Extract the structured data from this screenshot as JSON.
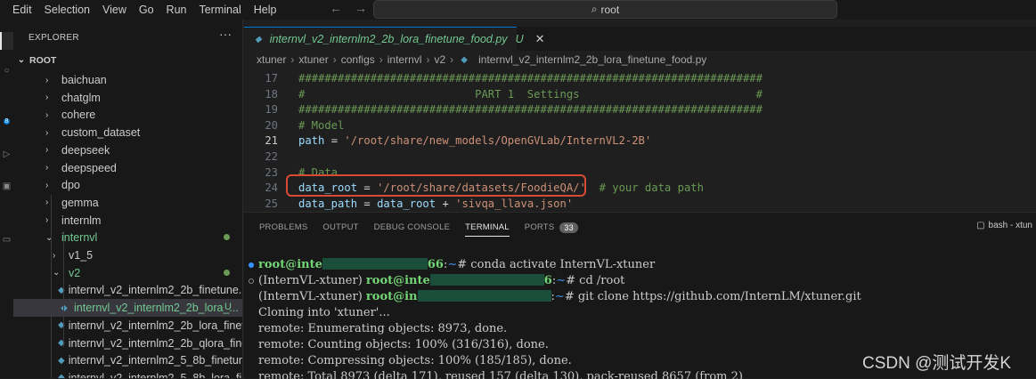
{
  "menubar": {
    "items": [
      "Edit",
      "Selection",
      "View",
      "Go",
      "Run",
      "Terminal",
      "Help"
    ]
  },
  "search": {
    "text": "root"
  },
  "sidebar": {
    "title": "EXPLORER",
    "more": "···",
    "root_label": "ROOT",
    "items": [
      {
        "label": "baichuan",
        "depth": 1,
        "chevron": "›"
      },
      {
        "label": "chatglm",
        "depth": 1,
        "chevron": "›"
      },
      {
        "label": "cohere",
        "depth": 1,
        "chevron": "›"
      },
      {
        "label": "custom_dataset",
        "depth": 1,
        "chevron": "›"
      },
      {
        "label": "deepseek",
        "depth": 1,
        "chevron": "›"
      },
      {
        "label": "deepspeed",
        "depth": 1,
        "chevron": "›"
      },
      {
        "label": "dpo",
        "depth": 1,
        "chevron": "›"
      },
      {
        "label": "gemma",
        "depth": 1,
        "chevron": "›"
      },
      {
        "label": "internlm",
        "depth": 1,
        "chevron": "›"
      },
      {
        "label": "internvl",
        "depth": 1,
        "chevron": "⌄",
        "green": true,
        "dot": true
      },
      {
        "label": "v1_5",
        "depth": 2,
        "chevron": "›"
      },
      {
        "label": "v2",
        "depth": 2,
        "chevron": "⌄",
        "green": true,
        "dot": true
      },
      {
        "label": "internvl_v2_internlm2_2b_finetune.py",
        "depth": 3,
        "file": true
      },
      {
        "label": "internvl_v2_internlm2_2b_lora_...",
        "depth": 3,
        "file": true,
        "green": true,
        "selected": true,
        "badge": "U"
      },
      {
        "label": "internvl_v2_internlm2_2b_lora_finet...",
        "depth": 3,
        "file": true
      },
      {
        "label": "internvl_v2_internlm2_2b_qlora_fine...",
        "depth": 3,
        "file": true
      },
      {
        "label": "internvl_v2_internlm2_5_8b_finetun...",
        "depth": 3,
        "file": true
      },
      {
        "label": "internvl_v2_internlm2_5_8b_lora_fi...",
        "depth": 3,
        "file": true
      }
    ]
  },
  "tab": {
    "title": "internvl_v2_internlm2_2b_lora_finetune_food.py",
    "status": "U",
    "close": "✕"
  },
  "breadcrumb": [
    "xtuner",
    "xtuner",
    "configs",
    "internvl",
    "v2",
    "internvl_v2_internlm2_2b_lora_finetune_food.py"
  ],
  "editor": {
    "lines": [
      {
        "n": "17",
        "parts": [
          [
            "com",
            "#######################################################################"
          ]
        ]
      },
      {
        "n": "18",
        "parts": [
          [
            "com",
            "#                          PART 1  Settings                           #"
          ]
        ]
      },
      {
        "n": "19",
        "parts": [
          [
            "com",
            "#######################################################################"
          ]
        ]
      },
      {
        "n": "20",
        "parts": [
          [
            "com",
            "# Model"
          ]
        ]
      },
      {
        "n": "21",
        "cur": true,
        "parts": [
          [
            "var",
            "path"
          ],
          [
            "op",
            " = "
          ],
          [
            "str",
            "'/root/share/new_models/OpenGVLab/InternVL2-2B'"
          ]
        ]
      },
      {
        "n": "22",
        "parts": []
      },
      {
        "n": "23",
        "parts": [
          [
            "com",
            "# Data"
          ]
        ]
      },
      {
        "n": "24",
        "parts": [
          [
            "var",
            "data_root"
          ],
          [
            "op",
            " = "
          ],
          [
            "str",
            "'/root/share/datasets/FoodieQA/'"
          ],
          [
            "op",
            "  "
          ],
          [
            "com",
            "# your data path"
          ]
        ]
      },
      {
        "n": "25",
        "parts": [
          [
            "var",
            "data_path"
          ],
          [
            "op",
            " = "
          ],
          [
            "var",
            "data_root"
          ],
          [
            "op",
            " + "
          ],
          [
            "str",
            "'sivqa_llava.json'"
          ]
        ]
      }
    ]
  },
  "panel": {
    "tabs": [
      "PROBLEMS",
      "OUTPUT",
      "DEBUG CONSOLE",
      "TERMINAL",
      "PORTS"
    ],
    "active_tab": "TERMINAL",
    "ports_count": "33",
    "terminal_label": "bash - xtun"
  },
  "terminal": {
    "lines": [
      {
        "dot": "filled",
        "segs": [
          [
            "user",
            "root@inte"
          ],
          [
            "redact",
            ""
          ],
          [
            "user",
            "66"
          ],
          [
            "plain",
            ":"
          ],
          [
            "path",
            "~"
          ],
          [
            "plain",
            "# conda activate InternVL-xtuner"
          ]
        ]
      },
      {
        "dot": "hollow",
        "segs": [
          [
            "plain",
            "(InternVL-xtuner) "
          ],
          [
            "user",
            "root@inte"
          ],
          [
            "redact",
            ""
          ],
          [
            "user",
            "6"
          ],
          [
            "plain",
            ":"
          ],
          [
            "path",
            "~"
          ],
          [
            "plain",
            "# cd /root"
          ]
        ]
      },
      {
        "dot": "",
        "segs": [
          [
            "plain",
            "(InternVL-xtuner) "
          ],
          [
            "user",
            "root@in"
          ],
          [
            "redact",
            ""
          ],
          [
            "plain",
            ":"
          ],
          [
            "path",
            "~"
          ],
          [
            "plain",
            "# git clone https://github.com/InternLM/xtuner.git"
          ]
        ]
      },
      {
        "dot": "",
        "segs": [
          [
            "plain",
            "Cloning into 'xtuner'..."
          ]
        ]
      },
      {
        "dot": "",
        "segs": [
          [
            "plain",
            "remote: Enumerating objects: 8973, done."
          ]
        ]
      },
      {
        "dot": "",
        "segs": [
          [
            "plain",
            "remote: Counting objects: 100% (316/316), done."
          ]
        ]
      },
      {
        "dot": "",
        "segs": [
          [
            "plain",
            "remote: Compressing objects: 100% (185/185), done."
          ]
        ]
      },
      {
        "dot": "",
        "segs": [
          [
            "plain",
            "remote: Total 8973 (delta 171), reused 157 (delta 130), pack-reused 8657 (from 2)"
          ]
        ]
      }
    ]
  },
  "watermark": "CSDN @测试开发K",
  "colors": {
    "accent": "#0078d4",
    "git_untracked": "#73c991",
    "annotation": "#d94a35"
  }
}
